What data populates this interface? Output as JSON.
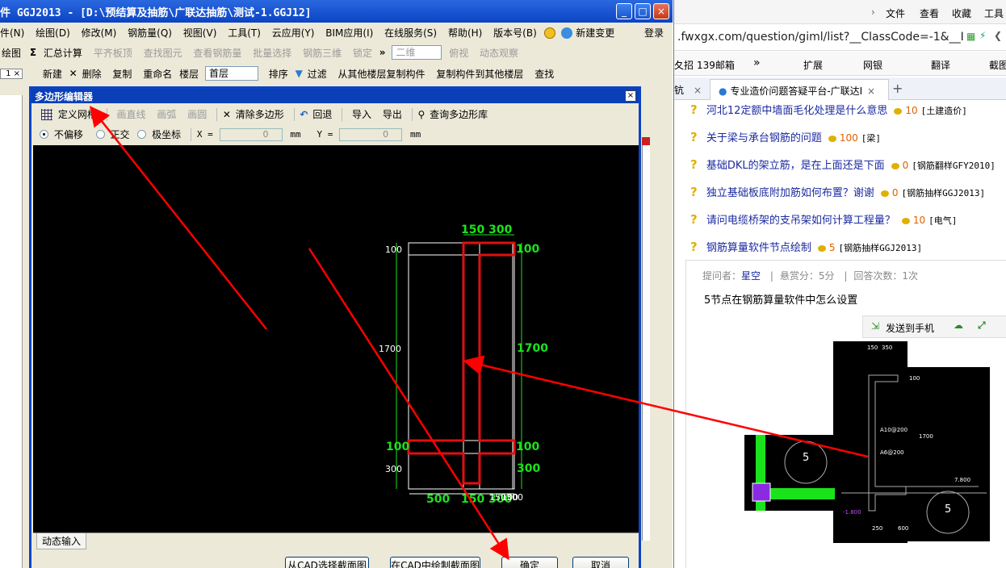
{
  "app": {
    "title": "件 GGJ2013 - [D:\\预结算及抽筋\\广联达抽筋\\测试-1.GGJ12]",
    "window_buttons": [
      "_",
      "□",
      "×"
    ]
  },
  "menubar": {
    "items": [
      "件(N)",
      "绘图(D)",
      "修改(M)",
      "钢筋量(Q)",
      "视图(V)",
      "工具(T)",
      "云应用(Y)",
      "BIM应用(I)",
      "在线服务(S)",
      "帮助(H)",
      "版本号(B)"
    ],
    "new_change": "新建变更",
    "login": "登录"
  },
  "toolbar1": {
    "draw": "绘图",
    "sum": "汇总计算",
    "flat_board": "平齐板顶",
    "find_element": "查找图元",
    "view_rebar": "查看钢筋量",
    "batch_select": "批量选择",
    "rebar_3d": "钢筋三维",
    "lock": "锁定",
    "view_mode": "二维",
    "top_view": "俯视",
    "dynamic_view": "动态观察"
  },
  "toolbar2": {
    "new": "新建",
    "delete": "删除",
    "copy": "复制",
    "rename": "重命名",
    "floor_label": "楼层",
    "floor_value": "首层",
    "sort": "排序",
    "filter": "过滤",
    "copy_from_floor": "从其他楼层复制构件",
    "copy_to_floor": "复制构件到其他楼层",
    "find": "查找"
  },
  "dialog": {
    "title": "多边形编辑器",
    "close": "×",
    "toolbar": {
      "define_grid": "定义网格",
      "draw_line": "画直线",
      "draw_arc": "画弧",
      "draw_circle": "画圆",
      "clear_polygon": "清除多边形",
      "undo": "回退",
      "import": "导入",
      "export": "导出",
      "query_library": "查询多边形库"
    },
    "options": {
      "no_offset": "不偏移",
      "ortho": "正交",
      "polar": "极坐标",
      "x_label": "X =",
      "x_value": "0",
      "y_label": "Y =",
      "y_value": "0",
      "unit": "mm"
    },
    "dims": {
      "top_green": "150 300",
      "right_top": "100",
      "right_mid": "1700",
      "right_low1": "100",
      "right_low2": "300",
      "left_top": "100",
      "left_mid": "1700",
      "left_low1": "100",
      "left_low2": "300",
      "bottom_green": "500",
      "bottom_green2": "150 300",
      "bottom_white": "150300",
      "bottom_white2": "100"
    },
    "dynamic_input_tab": "动态输入",
    "btn_select_cad": "从CAD选择截面图",
    "btn_draw_cad": "在CAD中绘制截面图",
    "btn_ok": "确定",
    "btn_cancel": "取消"
  },
  "browser": {
    "menu": [
      "文件",
      "查看",
      "收藏",
      "工具"
    ],
    "url": ".fwxgx.com/question/giml/list?__ClassCode=-1&__I",
    "bookmarks": {
      "first": "夂招",
      "mail": "139邮箱",
      "more": "»",
      "ext": "扩展",
      "bank": "网银",
      "translate": "翻译",
      "screenshot": "截图"
    },
    "tab_partial": "钪",
    "tab_active": "专业造价问题答疑平台-广联达I",
    "questions": [
      {
        "title": "河北12定额中墙面毛化处理是什么意思",
        "reward": "10",
        "tag": "[土建造价]"
      },
      {
        "title": "关于梁与承台钢筋的问题",
        "reward": "100",
        "tag": "[梁]"
      },
      {
        "title": "基础DKL的架立筋，是在上面还是下面",
        "reward": "0",
        "tag": "[钢筋翻样GFY2010]"
      },
      {
        "title": "独立基础板底附加筋如何布置？谢谢",
        "reward": "0",
        "tag": "[钢筋抽样GGJ2013]"
      },
      {
        "title": "请问电缆桥架的支吊架如何计算工程量？",
        "reward": "10",
        "tag": "[电气]"
      },
      {
        "title": "钢筋算量软件节点绘制",
        "reward": "5",
        "tag": "[钢筋抽样GGJ2013]"
      }
    ],
    "meta": {
      "asker_label": "提问者：",
      "asker": "星空",
      "bounty": "悬赏分：5分",
      "answers": "回答次数：1次"
    },
    "question_text": "5节点在钢筋算量软件中怎么设置",
    "send_to_phone": "发送到手机",
    "cad": {
      "dim_150": "150",
      "dim_350": "350",
      "dim_100": "100",
      "dim_1700": "1700",
      "rebar1": "A10@200",
      "rebar2": "A6@200",
      "node_left": "5",
      "node_right": "5",
      "elev": "7.800",
      "elev2": "-1.800",
      "dim_250": "250",
      "dim_600": "600"
    }
  },
  "colors": {
    "xp_blue": "#0b44c4",
    "cad_green": "#1be31b",
    "polygon_red": "#e01010",
    "arrow_red": "#ff0000",
    "link_blue": "#1b2aa0"
  }
}
